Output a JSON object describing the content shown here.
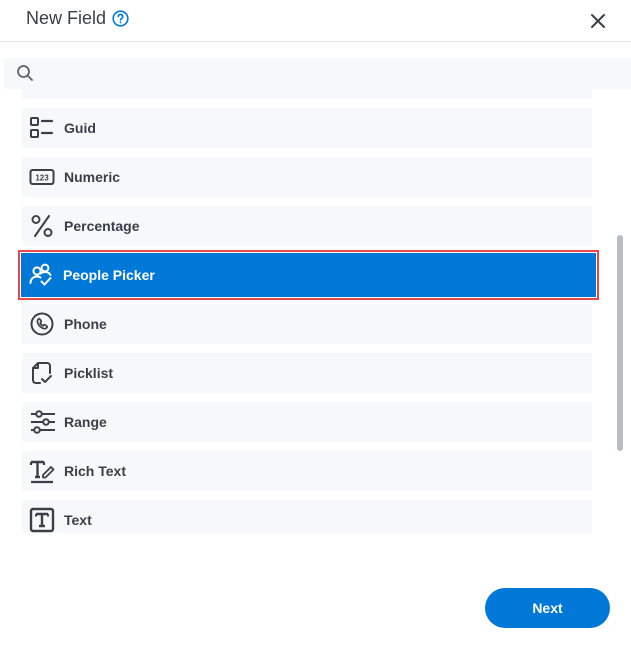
{
  "dialog": {
    "title": "New Field",
    "help_icon": "question-circle-icon",
    "close_icon": "close-icon"
  },
  "search": {
    "icon": "search-icon",
    "value": "",
    "placeholder": ""
  },
  "field_types": [
    {
      "label": "",
      "icon": "unknown-icon",
      "partial": true
    },
    {
      "label": "Guid",
      "icon": "guid-list-icon"
    },
    {
      "label": "Numeric",
      "icon": "numeric-123-icon"
    },
    {
      "label": "Percentage",
      "icon": "percent-icon"
    },
    {
      "label": "People Picker",
      "icon": "people-check-icon",
      "selected": true
    },
    {
      "label": "Phone",
      "icon": "phone-icon"
    },
    {
      "label": "Picklist",
      "icon": "picklist-icon"
    },
    {
      "label": "Range",
      "icon": "sliders-icon"
    },
    {
      "label": "Rich Text",
      "icon": "rich-text-icon"
    },
    {
      "label": "Text",
      "icon": "text-box-icon"
    }
  ],
  "colors": {
    "accent": "#0078d7",
    "selection_outline": "#e8474b",
    "item_bg": "#f7f8fa",
    "text": "#3a404a"
  },
  "footer": {
    "next_label": "Next"
  }
}
